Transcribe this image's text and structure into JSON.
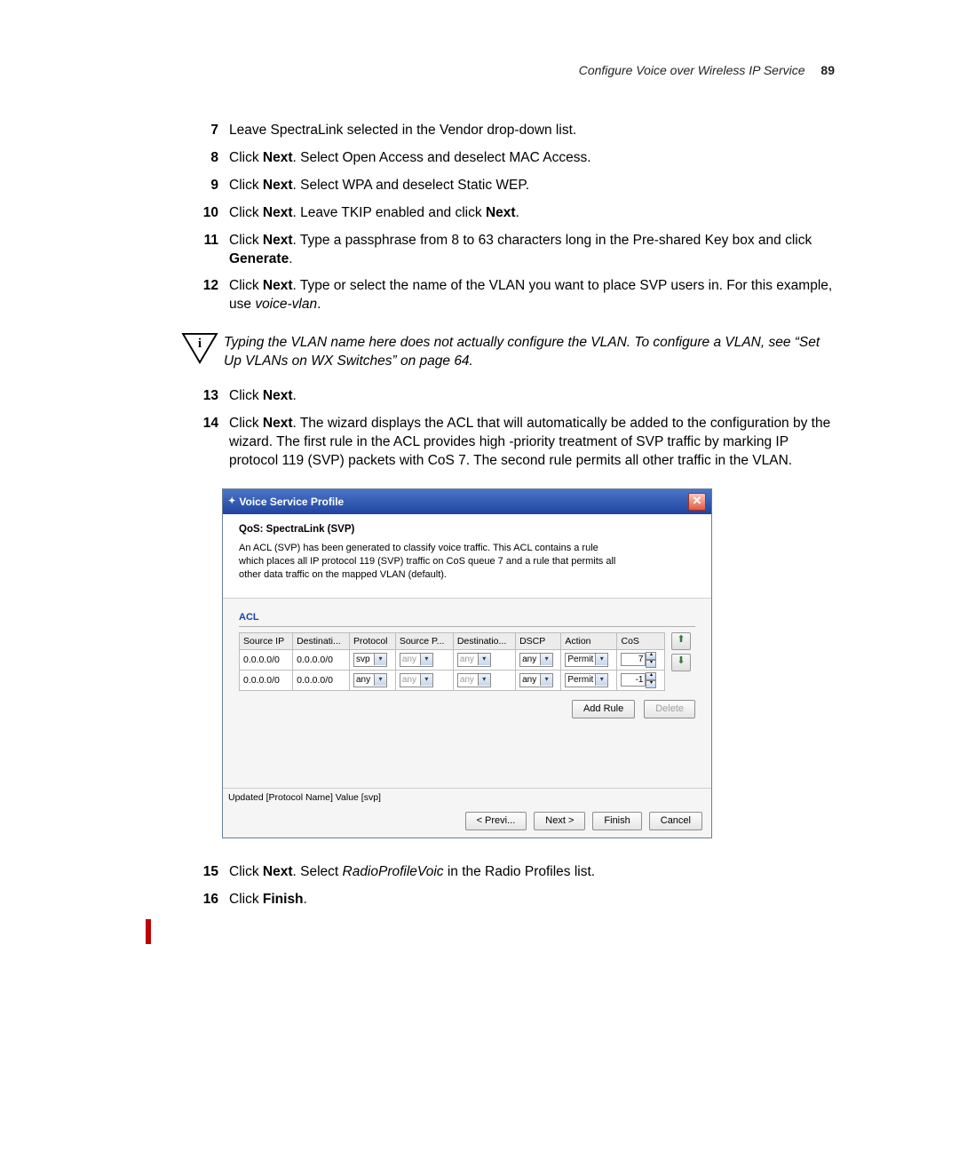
{
  "header": {
    "title": "Configure Voice over Wireless IP Service",
    "page": "89"
  },
  "steps": [
    {
      "n": "7",
      "html": "Leave SpectraLink selected in the Vendor drop-down list."
    },
    {
      "n": "8",
      "html": "Click <b>Next</b>. Select Open Access and deselect MAC Access."
    },
    {
      "n": "9",
      "html": "Click <b>Next</b>. Select WPA and deselect Static WEP."
    },
    {
      "n": "10",
      "html": "Click <b>Next</b>. Leave TKIP enabled and click <b>Next</b>."
    },
    {
      "n": "11",
      "html": "Click <b>Next</b>. Type a passphrase from 8 to 63 characters long in the Pre-shared Key box and click <b>Generate</b>."
    },
    {
      "n": "12",
      "html": "Click <b>Next</b>. Type or select the name of the VLAN you want to place SVP users in. For this example, use <i>voice-vlan</i>."
    }
  ],
  "note": "Typing the VLAN name here does not actually configure the VLAN. To configure a VLAN, see “Set Up VLANs on WX Switches” on page 64.",
  "steps2": [
    {
      "n": "13",
      "html": "Click <b>Next</b>."
    },
    {
      "n": "14",
      "html": "Click <b>Next</b>. The wizard displays the ACL that will automatically be added to the configuration by the wizard. The first rule in the ACL provides high -priority treatment of SVP traffic by marking IP protocol 119 (SVP) packets with CoS 7. The second rule permits all other traffic in the VLAN."
    }
  ],
  "dialog": {
    "title": "Voice Service Profile",
    "qos": "QoS: SpectraLink (SVP)",
    "desc": "An ACL (SVP) has been generated to classify voice traffic. This ACL contains a rule which places all IP protocol 119 (SVP) traffic on CoS queue 7 and a rule that permits all other data traffic on the mapped VLAN (default).",
    "aclHeader": "ACL",
    "columns": [
      "Source IP",
      "Destinati...",
      "Protocol",
      "Source P...",
      "Destinatio...",
      "DSCP",
      "Action",
      "CoS"
    ],
    "rows": [
      {
        "src": "0.0.0.0/0",
        "dst": "0.0.0.0/0",
        "proto": "svp",
        "sp": "any",
        "dp": "any",
        "dscp": "any",
        "action": "Permit",
        "cos": "7"
      },
      {
        "src": "0.0.0.0/0",
        "dst": "0.0.0.0/0",
        "proto": "any",
        "sp": "any",
        "dp": "any",
        "dscp": "any",
        "action": "Permit",
        "cos": "-1"
      }
    ],
    "addRule": "Add Rule",
    "delete": "Delete",
    "status": "Updated [Protocol Name] Value [svp]",
    "footer": {
      "prev": "< Previ...",
      "next": "Next >",
      "finish": "Finish",
      "cancel": "Cancel"
    }
  },
  "steps3": [
    {
      "n": "15",
      "html": "Click <b>Next</b>. Select <i>RadioProfileVoic</i> in the Radio Profiles list."
    },
    {
      "n": "16",
      "html": "Click <b>Finish</b>."
    }
  ]
}
